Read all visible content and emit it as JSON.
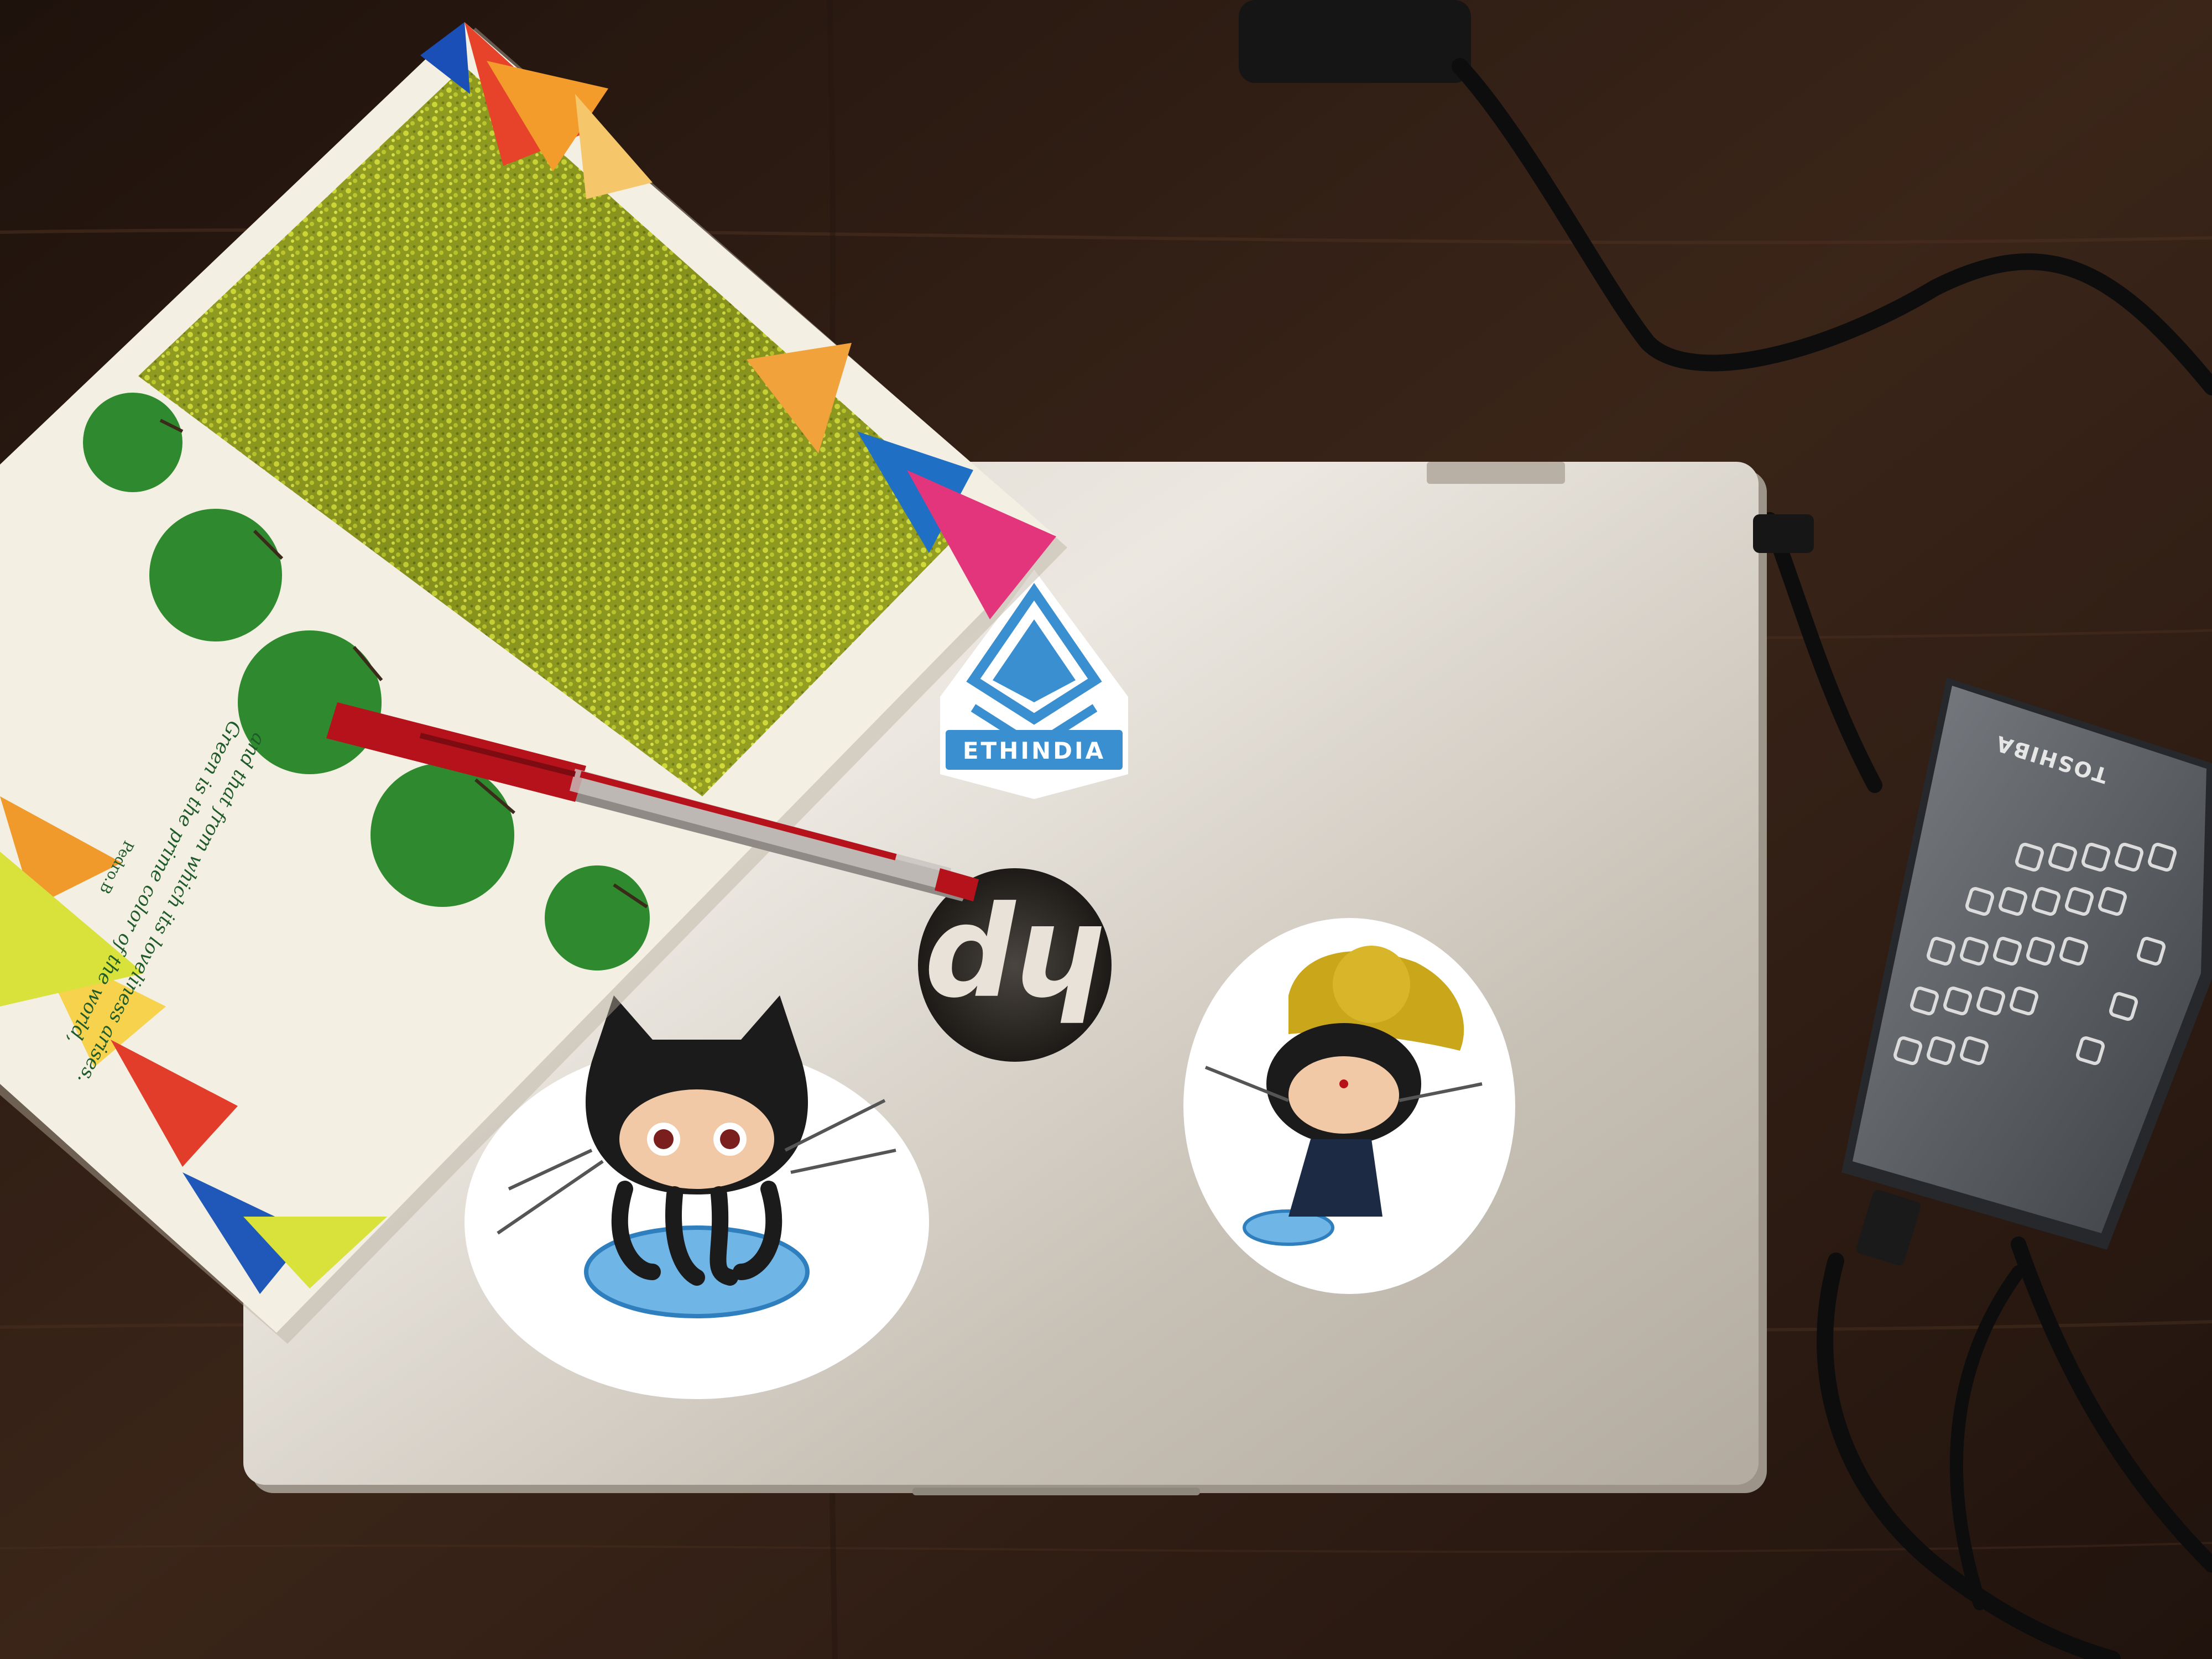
{
  "scene": {
    "description_free": true,
    "colors": {
      "desk": "#2a1a12",
      "desk_grain": "#3a2419",
      "laptop_lid": "#c9c2b8",
      "laptop_highlight": "#e9e4dc",
      "notebook_yellow": "#d8e23a",
      "pen_red": "#b5121b",
      "drive_gray": "#5b5f64",
      "cable": "#0e0e0e",
      "sticker_blue": "#3a8fd0"
    }
  },
  "notebook": {
    "quote_line1": "Green is the prime color of the world,",
    "quote_line2": "and that from which its loveliness arises.",
    "attribution": "Pedro.B"
  },
  "stickers": {
    "ethindia_label": "ETHINDIA"
  },
  "laptop": {
    "brand_logo": "hp"
  },
  "drive": {
    "brand": "TOSHIBA"
  },
  "icons": [
    "hp-logo-icon",
    "ethereum-diamond-icon",
    "octocat-icon",
    "mona-dancer-icon",
    "pen-icon"
  ]
}
